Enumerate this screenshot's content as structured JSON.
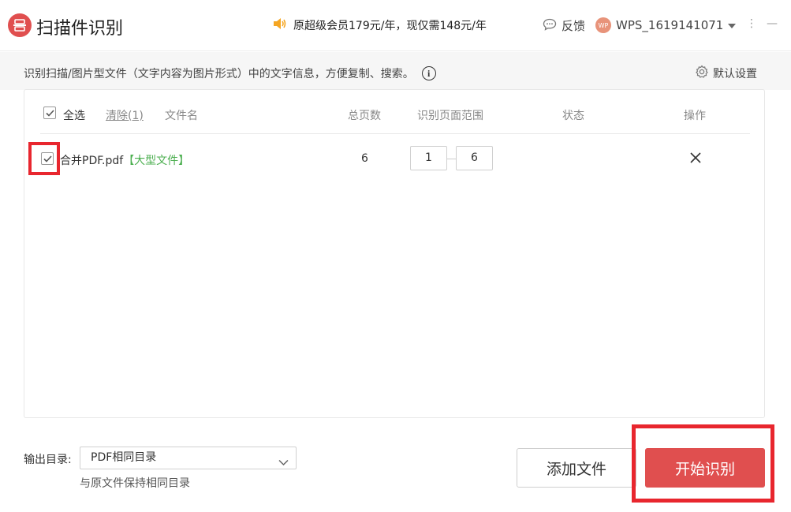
{
  "app": {
    "title": "扫描件识别",
    "promo_text": "原超级会员179元/年，现仅需148元/年",
    "feedback_label": "反馈",
    "username": "WPS_1619141071",
    "avatar_text": "WP",
    "minimize_label": "—",
    "restore_label": "⋮"
  },
  "subheader": {
    "description": "识别扫描/图片型文件（文字内容为图片形式）中的文字信息，方便复制、搜索。",
    "info_icon_text": "i",
    "settings_label": "默认设置"
  },
  "table": {
    "select_all_label": "全选",
    "clear_label": "清除(1)",
    "columns": {
      "filename": "文件名",
      "total_pages": "总页数",
      "range": "识别页面范围",
      "status": "状态",
      "action": "操作"
    },
    "rows": [
      {
        "checked": true,
        "filename": "合并PDF.pdf",
        "tag": "【大型文件】",
        "total_pages": "6",
        "range_start": "1",
        "range_end": "6",
        "status": ""
      }
    ]
  },
  "output": {
    "label": "输出目录:",
    "selected": "PDF相同目录",
    "hint": "与原文件保持相同目录"
  },
  "buttons": {
    "add_file": "添加文件",
    "start": "开始识别"
  },
  "colors": {
    "brand_red": "#e04f4f",
    "highlight_red": "#e8262e",
    "tag_green": "#4caf50",
    "promo_orange": "#f5a623"
  }
}
